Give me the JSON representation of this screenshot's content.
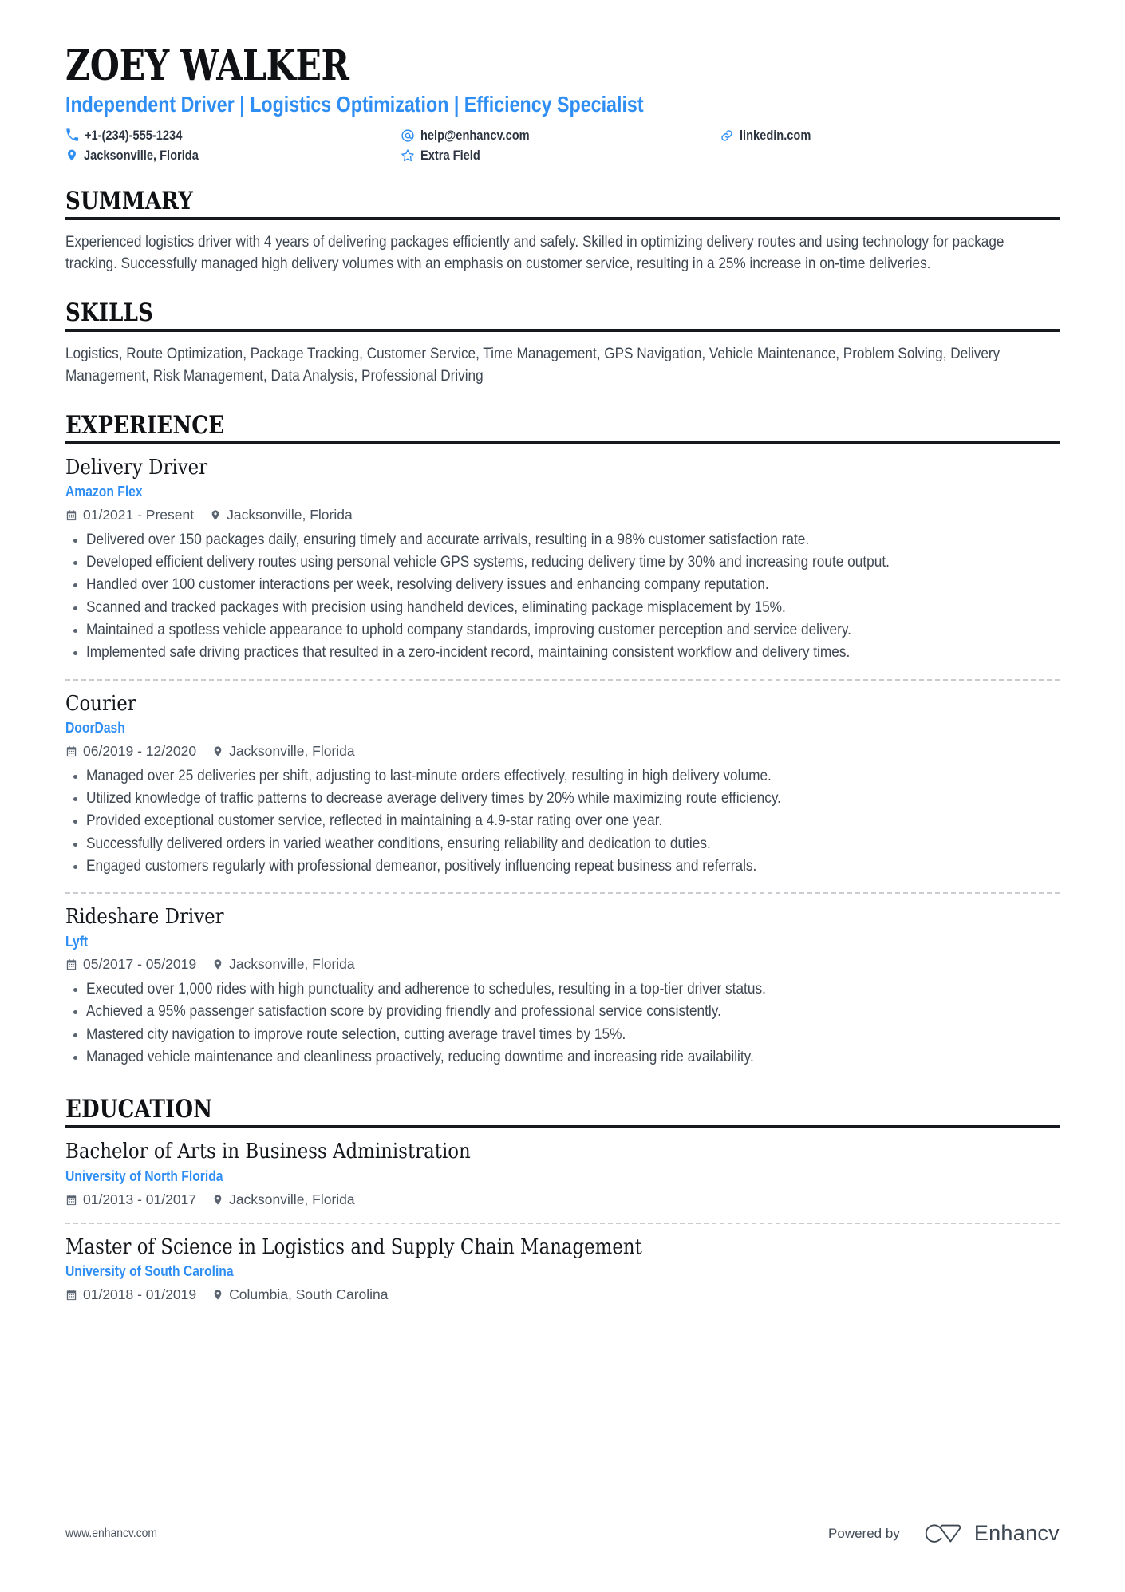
{
  "header": {
    "full_name": "ZOEY WALKER",
    "headline": "Independent Driver | Logistics Optimization | Efficiency Specialist",
    "contacts": [
      {
        "icon": "phone-icon",
        "text": "+1-(234)-555-1234"
      },
      {
        "icon": "email-icon",
        "text": "help@enhancv.com"
      },
      {
        "icon": "link-icon",
        "text": "linkedin.com"
      },
      {
        "icon": "location-pin-icon",
        "text": "Jacksonville, Florida"
      },
      {
        "icon": "star-icon",
        "text": "Extra Field"
      }
    ]
  },
  "summary": {
    "title": "SUMMARY",
    "text": "Experienced logistics driver with 4 years of delivering packages efficiently and safely. Skilled in optimizing delivery routes and using technology for package tracking. Successfully managed high delivery volumes with an emphasis on customer service, resulting in a 25% increase in on-time deliveries."
  },
  "skills": {
    "title": "SKILLS",
    "text": "Logistics, Route Optimization, Package Tracking, Customer Service, Time Management, GPS Navigation, Vehicle Maintenance, Problem Solving, Delivery Management, Risk Management, Data Analysis, Professional Driving",
    "list": [
      "Logistics",
      "Route Optimization",
      "Package Tracking",
      "Customer Service",
      "Time Management",
      "GPS Navigation",
      "Vehicle Maintenance",
      "Problem Solving",
      "Delivery Management",
      "Risk Management",
      "Data Analysis",
      "Professional Driving"
    ]
  },
  "experience": {
    "title": "EXPERIENCE",
    "entries": [
      {
        "role": "Delivery Driver",
        "company": "Amazon Flex",
        "dates": "01/2021 - Present",
        "location": "Jacksonville, Florida",
        "bullets": [
          "Delivered over 150 packages daily, ensuring timely and accurate arrivals, resulting in a 98% customer satisfaction rate.",
          "Developed efficient delivery routes using personal vehicle GPS systems, reducing delivery time by 30% and increasing route output.",
          "Handled over 100 customer interactions per week, resolving delivery issues and enhancing company reputation.",
          "Scanned and tracked packages with precision using handheld devices, eliminating package misplacement by 15%.",
          "Maintained a spotless vehicle appearance to uphold company standards, improving customer perception and service delivery.",
          "Implemented safe driving practices that resulted in a zero-incident record, maintaining consistent workflow and delivery times."
        ]
      },
      {
        "role": "Courier",
        "company": "DoorDash",
        "dates": "06/2019 - 12/2020",
        "location": "Jacksonville, Florida",
        "bullets": [
          "Managed over 25 deliveries per shift, adjusting to last-minute orders effectively, resulting in high delivery volume.",
          "Utilized knowledge of traffic patterns to decrease average delivery times by 20% while maximizing route efficiency.",
          "Provided exceptional customer service, reflected in maintaining a 4.9-star rating over one year.",
          "Successfully delivered orders in varied weather conditions, ensuring reliability and dedication to duties.",
          "Engaged customers regularly with professional demeanor, positively influencing repeat business and referrals."
        ]
      },
      {
        "role": "Rideshare Driver",
        "company": "Lyft",
        "dates": "05/2017 - 05/2019",
        "location": "Jacksonville, Florida",
        "bullets": [
          "Executed over 1,000 rides with high punctuality and adherence to schedules, resulting in a top-tier driver status.",
          "Achieved a 95% passenger satisfaction score by providing friendly and professional service consistently.",
          "Mastered city navigation to improve route selection, cutting average travel times by 15%.",
          "Managed vehicle maintenance and cleanliness proactively, reducing downtime and increasing ride availability."
        ]
      }
    ]
  },
  "education": {
    "title": "EDUCATION",
    "entries": [
      {
        "degree": "Bachelor of Arts in Business Administration",
        "school": "University of North Florida",
        "dates": "01/2013 - 01/2017",
        "location": "Jacksonville, Florida"
      },
      {
        "degree": "Master of Science in Logistics and Supply Chain Management",
        "school": "University of South Carolina",
        "dates": "01/2018 - 01/2019",
        "location": "Columbia, South Carolina"
      }
    ]
  },
  "footer": {
    "url": "www.enhancv.com",
    "powered_by": "Powered by",
    "brand_name": "Enhancv"
  },
  "colors": {
    "accent_blue": "#2f8ef4",
    "heading_black": "#0f1114",
    "body_gray": "#3f4852",
    "meta_gray": "#4a535e",
    "divider_gray": "#c9ccd1"
  }
}
